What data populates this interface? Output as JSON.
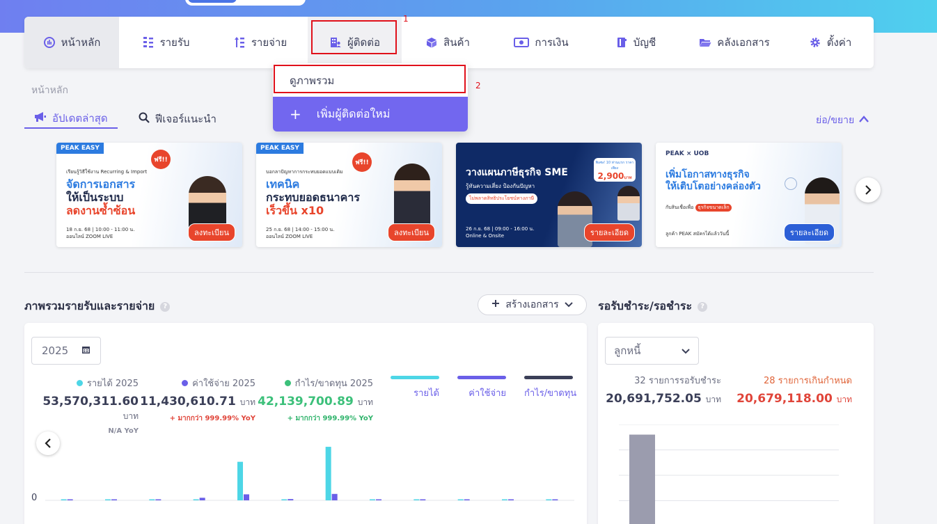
{
  "nav": {
    "items": [
      {
        "label": "หน้าหลัก",
        "icon": "dashboard-gauge-icon"
      },
      {
        "label": "รายรับ",
        "icon": "income-sort-icon"
      },
      {
        "label": "รายจ่าย",
        "icon": "expense-sort-icon"
      },
      {
        "label": "ผู้ติดต่อ",
        "icon": "contacts-building-icon"
      },
      {
        "label": "สินค้า",
        "icon": "product-box-icon"
      },
      {
        "label": "การเงิน",
        "icon": "money-bill-icon"
      },
      {
        "label": "บัญชี",
        "icon": "accounting-book-icon"
      },
      {
        "label": "คลังเอกสาร",
        "icon": "folder-open-icon"
      },
      {
        "label": "ตั้งค่า",
        "icon": "gear-icon"
      }
    ]
  },
  "annotations": {
    "step1": "1",
    "step2": "2"
  },
  "dropdown": {
    "view_all": "ดูภาพรวม",
    "add_new": "เพิ่มผู้ติดต่อใหม่",
    "add_icon": "+"
  },
  "breadcrumb": "หน้าหลัก",
  "tabs": {
    "latest": "อัปเดตล่าสุด",
    "recommended": "ฟีเจอร์แนะนำ"
  },
  "collapse_label": "ย่อ/ขยาย",
  "banners": [
    {
      "tag": "PEAK EASY",
      "badge": "ฟรี!!",
      "sub": "เรียนรู้วิธีใช้งาน Recurring & Import",
      "title1": "จัดการเอกสาร",
      "title2": "ให้เป็นระบบ",
      "title3": "ลดงานซ้ำซ้อน",
      "info": "18 ก.ย. 68 | 10:00 - 11:00 น.",
      "info2": "ออนไลน์ ZOOM LIVE",
      "cta": "ลงทะเบียน"
    },
    {
      "tag": "PEAK EASY",
      "badge": "ฟรี!!",
      "sub": "บอกลาปัญหาการกระทบยอดแบบเดิม",
      "title1": "เทคนิค",
      "title2": "กระทบยอดธนาคาร",
      "title3": "เร็วขึ้น x10",
      "info": "25 ก.ย. 68 | 14:00 - 15:00 น.",
      "info2": "ออนไลน์ ZOOM LIVE",
      "cta": "ลงทะเบียน"
    },
    {
      "title1": "วางแผนภาษีธุรกิจ SME",
      "sub": "รู้ทันความเสี่ยง ป้องกันปัญหา",
      "highlight": "ไม่พลาดสิทธิประโยชน์ทางภาษี",
      "price_note": "พิเศษ! 10 ท่านแรก ราคาเพียง",
      "price": "2,900",
      "price_unit": "บาท",
      "info": "26 ก.ย. 68 | 09:00 - 16:00 น.",
      "info2": "Online & Onsite",
      "cta": "รายละเอียด"
    },
    {
      "brand": "PEAK × UOB",
      "title1": "เพิ่มโอกาสทางธุรกิจ",
      "title2": "ให้เติบโตอย่างคล่องตัว",
      "sub": "กับสินเชื่อเพื่อ",
      "highlight": "ธุรกิจขนาดเล็ก",
      "info": "ลูกค้า PEAK สมัครได้แล้ววันนี้",
      "cta": "รายละเอียด"
    }
  ],
  "overview": {
    "title": "ภาพรวมรายรับและรายจ่าย",
    "create_label": "สร้างเอกสาร",
    "year": "2025",
    "stats": [
      {
        "label": "รายได้ 2025",
        "value": "53,570,311.60",
        "unit": "บาท",
        "yoy": "N/A YoY",
        "color": "#4dd6e6",
        "yoy_color": "#8a8c9c"
      },
      {
        "label": "ค่าใช้จ่าย 2025",
        "value": "11,430,610.71",
        "unit": "บาท",
        "yoy": "+ มากกว่า 999.99% YoY",
        "color": "#6a5fe8",
        "yoy_color": "#e0453a"
      },
      {
        "label": "กำไร/ขาดทุน 2025",
        "value": "42,139,700.89",
        "unit": "บาท",
        "yoy": "+ มากกว่า 999.99% YoY",
        "color": "#3cc07a",
        "yoy_color": "#2fb36b"
      }
    ],
    "legend": [
      {
        "label": "รายได้",
        "color": "#4dd6e6"
      },
      {
        "label": "ค่าใช้จ่าย",
        "color": "#6a5fe8"
      },
      {
        "label": "กำไร/ขาดทุน",
        "color": "#3b3f58"
      }
    ]
  },
  "chart_data": {
    "type": "bar",
    "ytick_zero": "0",
    "series": [
      {
        "name": "รายได้",
        "values": [
          0.05,
          0.05,
          0.05,
          0.05,
          18.0,
          0.1,
          25.0,
          0.1,
          0.1,
          0.1,
          0.1,
          0.1
        ]
      },
      {
        "name": "ค่าใช้จ่าย",
        "values": [
          0.3,
          0.4,
          0.3,
          1.2,
          2.8,
          0.6,
          3.0,
          0.3,
          0.2,
          0.3,
          0.3,
          0.4
        ]
      }
    ],
    "ymax": 26,
    "receivable_bars": [
      {
        "value": 20691752.05
      }
    ],
    "receivable_ymax": 23000000
  },
  "receivable": {
    "title": "รอรับชำระ/รอชำระ",
    "selector": "ลูกหนี้",
    "pending_label": "32 รายการรอรับชำระ",
    "pending_value": "20,691,752.05",
    "overdue_label": "28 รายการเกินกำหนด",
    "overdue_value": "20,679,118.00",
    "unit": "บาท"
  }
}
